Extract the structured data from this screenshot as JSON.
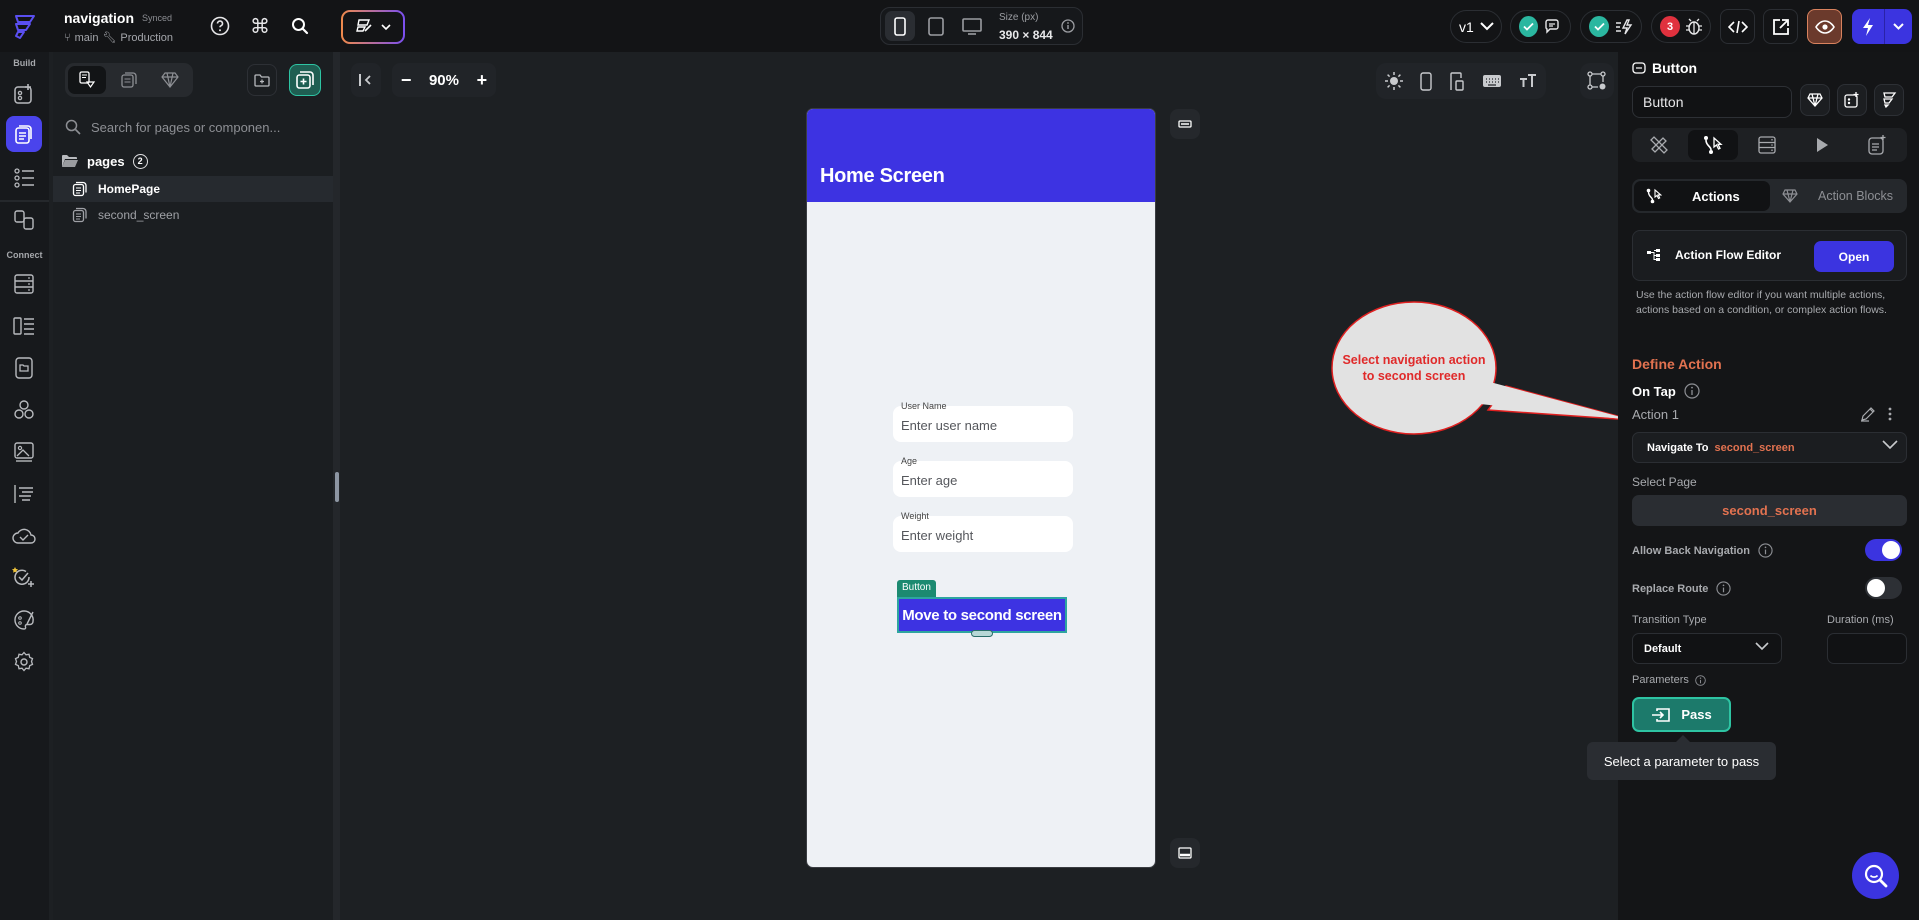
{
  "topbar": {
    "project_name": "navigation",
    "sync_status": "Synced",
    "branch": "main",
    "environment": "Production",
    "icons": [
      "help-icon",
      "command-icon",
      "search-icon"
    ],
    "theme_button_icon": "theme-wand-icon",
    "device": {
      "options": [
        "phone",
        "tablet",
        "desktop"
      ],
      "selected": "phone",
      "size_label": "Size (px)",
      "size_value": "390 × 844"
    },
    "version": "v1",
    "bug_count": "3",
    "colors": {
      "accent": "#3b34e0",
      "success": "#2bb7a0",
      "danger": "#e0313e",
      "preview": "#6b3a2c"
    }
  },
  "rail": {
    "build_label": "Build",
    "connect_label": "Connect",
    "build_items": [
      "add-widget",
      "pages",
      "widget-tree",
      "page-selector"
    ],
    "connect_items": [
      "firestore",
      "api-calls",
      "storage",
      "integrations",
      "media-assets",
      "app-values",
      "cloud-functions",
      "tests",
      "theme-settings",
      "settings"
    ],
    "active": "pages"
  },
  "pages_panel": {
    "search_placeholder": "Search for pages or componen...",
    "folder": {
      "name": "pages",
      "count": "2"
    },
    "pages": [
      {
        "name": "HomePage",
        "selected": true
      },
      {
        "name": "second_screen",
        "selected": false
      }
    ]
  },
  "canvas": {
    "zoom": "90%",
    "phone": {
      "appbar_title": "Home Screen",
      "fields": [
        {
          "label": "User Name",
          "placeholder": "Enter user name"
        },
        {
          "label": "Age",
          "placeholder": "Enter age"
        },
        {
          "label": "Weight",
          "placeholder": "Enter weight"
        }
      ],
      "selection_tag": "Button",
      "button_label": "Move to second screen"
    }
  },
  "callout": {
    "line1": "Select navigation action",
    "line2": "to second screen"
  },
  "properties": {
    "widget_type": "Button",
    "widget_name": "Button",
    "subtabs": {
      "actions": "Actions",
      "action_blocks": "Action Blocks"
    },
    "action_flow_editor": {
      "title": "Action Flow Editor",
      "open_label": "Open",
      "description": "Use the action flow editor if you want multiple actions, actions based on a condition, or complex action flows."
    },
    "define_action": "Define Action",
    "trigger": "On Tap",
    "action_name": "Action 1",
    "action_type": "Navigate To",
    "action_target": "second_screen",
    "select_page_label": "Select Page",
    "select_page_value": "second_screen",
    "allow_back_navigation": {
      "label": "Allow Back Navigation",
      "value": true
    },
    "replace_route": {
      "label": "Replace Route",
      "value": false
    },
    "transition_type": {
      "label": "Transition Type",
      "value": "Default"
    },
    "duration": {
      "label": "Duration (ms)",
      "value": ""
    },
    "parameters_label": "Parameters",
    "pass_label": "Pass",
    "tooltip": "Select a parameter to pass"
  }
}
